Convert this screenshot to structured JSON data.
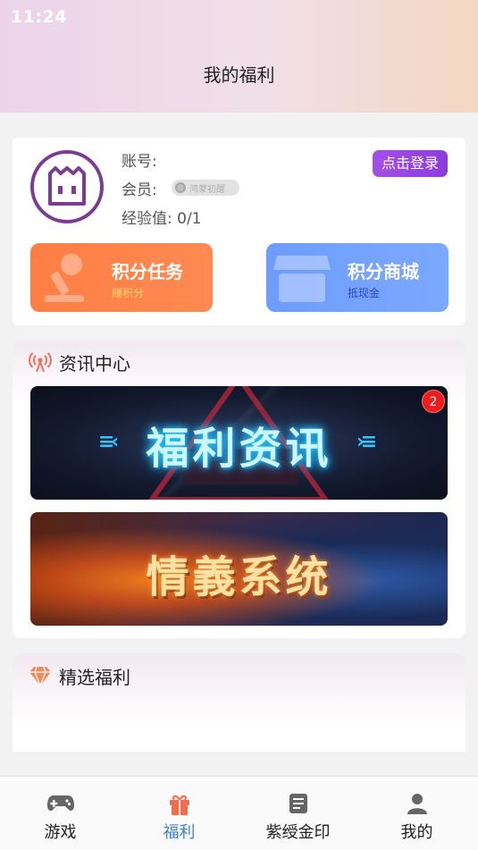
{
  "status_bar": {
    "time": "11:24"
  },
  "header": {
    "title": "我的福利"
  },
  "account": {
    "account_label": "账号:",
    "member_label": "会员:",
    "member_badge": "鸿蒙初醒",
    "exp_label": "经验值:",
    "exp_value": "0/1",
    "login_button": "点击登录"
  },
  "tiles": [
    {
      "title": "积分任务",
      "subtitle": "赚积分",
      "color": "#ff8048"
    },
    {
      "title": "积分商城",
      "subtitle": "抵现金",
      "color": "#76a3ff"
    }
  ],
  "news": {
    "title": "资讯中心",
    "banners": [
      {
        "text": "福利资讯",
        "badge": "2"
      },
      {
        "text": "情義系统"
      }
    ]
  },
  "featured": {
    "title": "精选福利"
  },
  "bottom_nav": {
    "active_color": "#3b82d8",
    "items": [
      {
        "label": "游戏",
        "icon": "gamepad-icon"
      },
      {
        "label": "福利",
        "icon": "gift-icon"
      },
      {
        "label": "紫绶金印",
        "icon": "document-icon"
      },
      {
        "label": "我的",
        "icon": "user-icon"
      }
    ]
  }
}
